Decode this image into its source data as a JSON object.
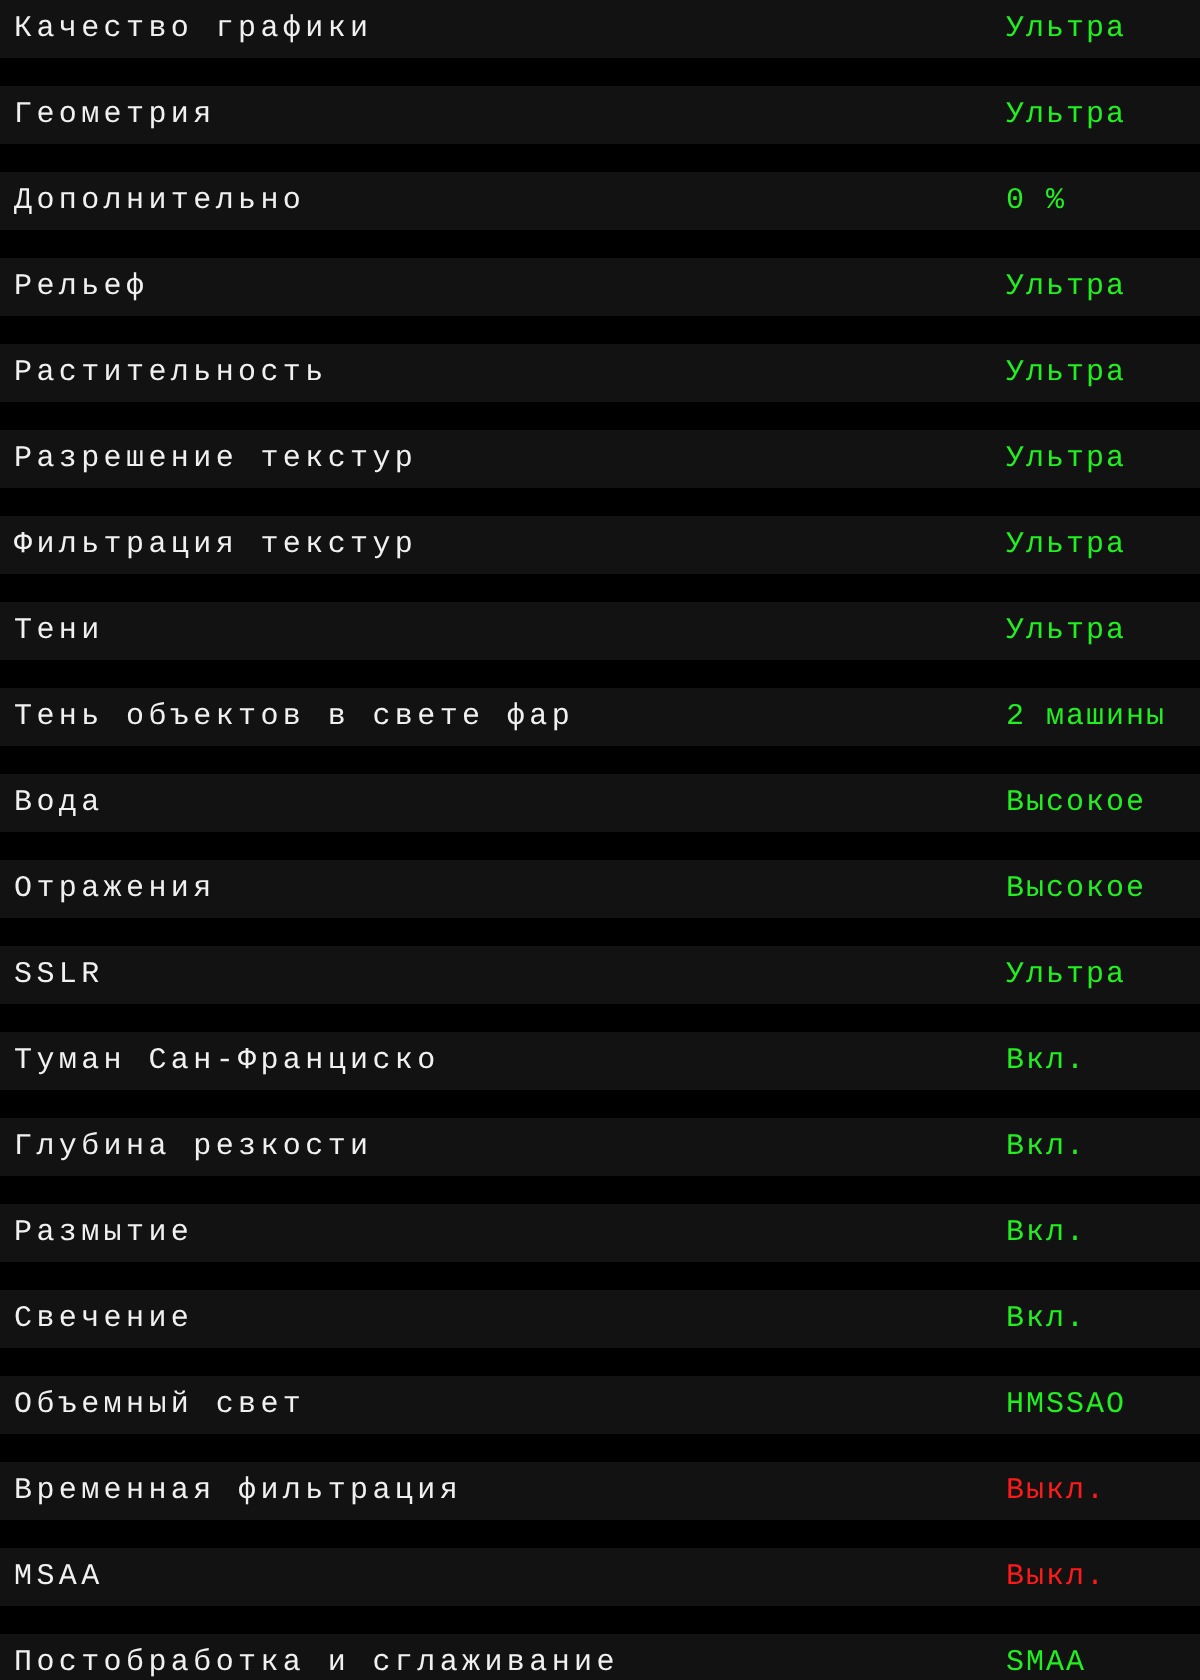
{
  "settings": [
    {
      "label": "Качество графики",
      "value": "Ультра",
      "off": false
    },
    {
      "label": "Геометрия",
      "value": "Ультра",
      "off": false
    },
    {
      "label": "Дополнительно",
      "value": "0 %",
      "off": false
    },
    {
      "label": "Рельеф",
      "value": "Ультра",
      "off": false
    },
    {
      "label": "Растительность",
      "value": "Ультра",
      "off": false
    },
    {
      "label": "Разрешение текстур",
      "value": "Ультра",
      "off": false
    },
    {
      "label": "Фильтрация текстур",
      "value": "Ультра",
      "off": false
    },
    {
      "label": "Тени",
      "value": "Ультра",
      "off": false
    },
    {
      "label": "Тень объектов в свете фар",
      "value": "2 машины",
      "off": false
    },
    {
      "label": "Вода",
      "value": "Высокое",
      "off": false
    },
    {
      "label": "Отражения",
      "value": "Высокое",
      "off": false
    },
    {
      "label": "SSLR",
      "value": "Ультра",
      "off": false
    },
    {
      "label": "Туман Сан-Франциско",
      "value": "Вкл.",
      "off": false
    },
    {
      "label": "Глубина резкости",
      "value": "Вкл.",
      "off": false
    },
    {
      "label": "Размытие",
      "value": "Вкл.",
      "off": false
    },
    {
      "label": "Свечение",
      "value": "Вкл.",
      "off": false
    },
    {
      "label": "Объемный свет",
      "value": "HMSSAO",
      "off": false
    },
    {
      "label": "Временная фильтрация",
      "value": "Выкл.",
      "off": true
    },
    {
      "label": "MSAA",
      "value": "Выкл.",
      "off": true
    },
    {
      "label": "Постобработка и сглаживание",
      "value": "SMAA",
      "off": false
    }
  ]
}
